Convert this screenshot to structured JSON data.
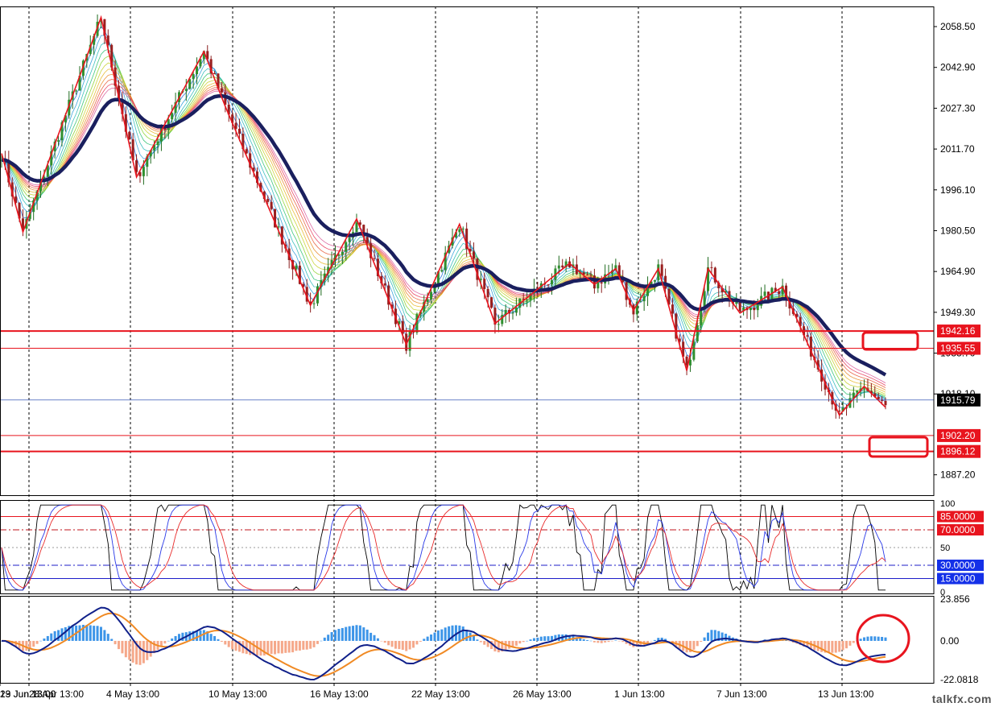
{
  "chart_data": {
    "type": "candlestick",
    "instrument_pane": {
      "y_ticks": [
        "2058.50",
        "2042.90",
        "2027.30",
        "2011.70",
        "1996.10",
        "1980.50",
        "1964.90",
        "1949.30",
        "1933.70",
        "1918.10",
        "1887.20"
      ],
      "ylim": [
        1879.4,
        2066.2
      ],
      "current_price": "1915.79",
      "levels": [
        {
          "label": "1942.16",
          "value": 1942.16,
          "color": "#e8141e",
          "width": 2
        },
        {
          "label": "1935.55",
          "value": 1935.55,
          "color": "#e8141e",
          "width": 1
        },
        {
          "label": "1902.20",
          "value": 1902.2,
          "color": "#e8141e",
          "width": 1
        },
        {
          "label": "1896.12",
          "value": 1896.12,
          "color": "#e8141e",
          "width": 2
        }
      ],
      "zigzag": [
        2010,
        1980,
        2062,
        2001,
        2049,
        2028,
        1952,
        1985,
        1937,
        1983,
        1945,
        1968,
        1960,
        1966,
        1950,
        1966,
        1927,
        1966,
        1949,
        1959,
        1910,
        1921,
        1913
      ],
      "ma_color": "#1a1f5e",
      "zigzag_color": "#e8141e"
    },
    "stochastic_pane": {
      "y_ticks": [
        "100",
        "50",
        "0"
      ],
      "ylim": [
        0,
        100
      ],
      "levels": [
        {
          "label": "85.0000",
          "value": 85,
          "color": "#e8141e",
          "style": "solid",
          "tag_color": "#e8141e"
        },
        {
          "label": "70.0000",
          "value": 70,
          "color": "#c0141e",
          "style": "dashdot",
          "tag_color": "#e8141e"
        },
        {
          "label": "30.0000",
          "value": 30,
          "color": "#1c1cc8",
          "style": "dashdot",
          "tag_color": "#1430e8"
        },
        {
          "label": "15.0000",
          "value": 15,
          "color": "#1c1cc8",
          "style": "solid",
          "tag_color": "#1430e8"
        }
      ]
    },
    "macd_pane": {
      "y_ticks": [
        "23.856",
        "0.00",
        "-22.0818"
      ],
      "ylim": [
        -22.0818,
        23.856
      ],
      "histogram_pos_color": "#3d95e8",
      "histogram_neg_color": "#f5a88a",
      "signal_color": "#f08a24",
      "main_color": "#10208a"
    },
    "x_tick_labels": [
      "28 Apr 13:00",
      "4 May 13:00",
      "10 May 13:00",
      "16 May 13:00",
      "22 May 13:00",
      "26 May 13:00",
      "1 Jun 13:00",
      "7 Jun 13:00",
      "13 Jun 13:00",
      "19 Jun 13:00",
      "23 Jun 13:00"
    ]
  },
  "watermark": "talkfx.com"
}
